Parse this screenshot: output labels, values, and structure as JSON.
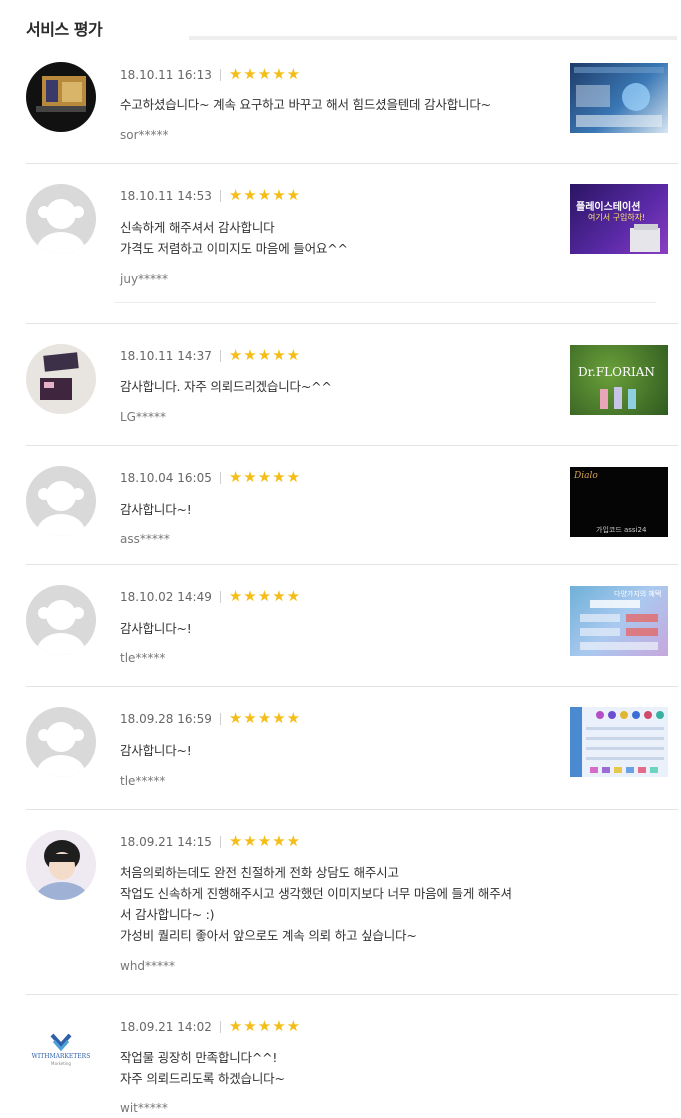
{
  "header": {
    "title": "서비스 평가"
  },
  "reviews": [
    {
      "date": "18.10.11 16:13",
      "rating": 5,
      "lines": [
        "수고하셨습니다~ 계속 요구하고 바꾸고 해서 힘드셨을텐데 감사합니다~"
      ],
      "user": "sor*****"
    },
    {
      "date": "18.10.11 14:53",
      "rating": 5,
      "lines": [
        "신속하게 해주셔서 감사합니다",
        "가격도 저렴하고 이미지도 마음에 들어요^^"
      ],
      "user": "juy*****",
      "thumb_text": [
        "플레이스테이션",
        "여기서 구입하자!"
      ]
    },
    {
      "date": "18.10.11 14:37",
      "rating": 5,
      "lines": [
        "감사합니다. 자주 의뢰드리겠습니다~^^"
      ],
      "user": "LG*****",
      "thumb_text": [
        "Dr.FLORIAN"
      ]
    },
    {
      "date": "18.10.04 16:05",
      "rating": 5,
      "lines": [
        "감사합니다~!"
      ],
      "user": "ass*****",
      "thumb_text": [
        "Dialo",
        "가입코드 assi24"
      ]
    },
    {
      "date": "18.10.02 14:49",
      "rating": 5,
      "lines": [
        "감사합니다~!"
      ],
      "user": "tle*****",
      "thumb_text": [
        "다양가지의 혜택"
      ]
    },
    {
      "date": "18.09.28 16:59",
      "rating": 5,
      "lines": [
        "감사합니다~!"
      ],
      "user": "tle*****"
    },
    {
      "date": "18.09.21 14:15",
      "rating": 5,
      "lines": [
        "처음의뢰하는데도 완전 친절하게 전화 상담도 해주시고",
        "작업도 신속하게 진행해주시고 생각했던 이미지보다 너무 마음에 들게 해주셔",
        "서 감사합니다~ :)",
        "가성비 퀄리티 좋아서 앞으로도 계속 의뢰 하고 싶습니다~"
      ],
      "user": "whd*****"
    },
    {
      "date": "18.09.21 14:02",
      "rating": 5,
      "lines": [
        "작업물 굉장히 만족합니다^^!",
        "자주 의뢰드리도록 하겠습니다~"
      ],
      "user": "wit*****",
      "avatar_text": [
        "WITHMARKETERS",
        "Marketing"
      ]
    }
  ],
  "colors": {
    "star": "#f5bd17",
    "divider": "#e3e3e3"
  }
}
